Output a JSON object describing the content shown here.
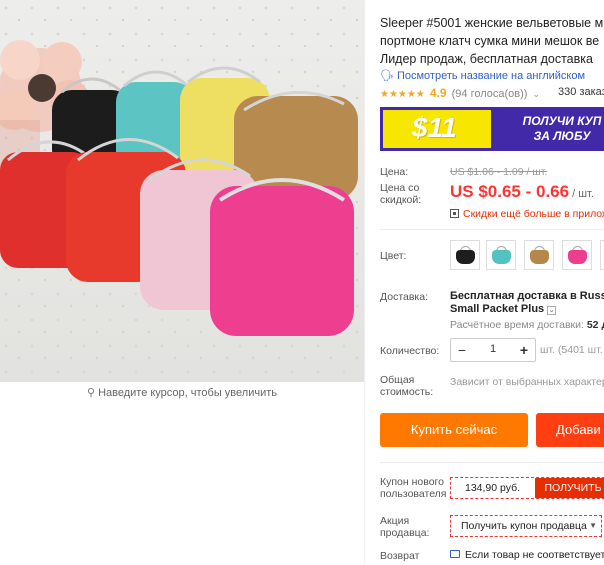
{
  "gallery": {
    "zoom_hint": "Наведите курсор, чтобы увеличить"
  },
  "product": {
    "title_lines": [
      "Sleeper #5001 женские вельветовые м",
      "портмоне клатч сумка мини мешок ве",
      "Лидер продаж, бесплатная доставка"
    ],
    "translate_link": "Посмотреть название на английском",
    "stars": "★★★★★",
    "rating": "4.9",
    "votes": "(94 голоса(ов))",
    "orders": "330 заказа"
  },
  "banner": {
    "amount": "$11",
    "promo_line1": "ПОЛУЧИ КУП",
    "promo_line2": "ЗА ЛЮБУ",
    "colors": {
      "background": "#4229a8",
      "accent": "#f7e600"
    }
  },
  "price": {
    "price_label": "Цена:",
    "old_price": "US $1.06 - 1.09 / шт.",
    "discount_label_line1": "Цена со",
    "discount_label_line2": "скидкой:",
    "current_price": "US $0.65 - 0.66",
    "unit": "/ шт.",
    "discount_note": "Скидки ещё больше в прилож"
  },
  "color": {
    "label": "Цвет:",
    "swatches": [
      {
        "name": "black",
        "color": "#1e1e1e"
      },
      {
        "name": "turquoise",
        "color": "#52c3c0"
      },
      {
        "name": "camel",
        "color": "#b4874a"
      },
      {
        "name": "pink",
        "color": "#ec3d8f"
      },
      {
        "name": "pale-pink",
        "color": "#f0c5d3"
      }
    ]
  },
  "shipping": {
    "label": "Доставка:",
    "method_line1": "Бесплатная доставка в Russian",
    "method_line2": "Small Packet Plus",
    "time_label": "Расчётное время доставки:",
    "time_value": "52 д"
  },
  "quantity": {
    "label": "Количество:",
    "value": "1",
    "minus": "−",
    "plus": "+",
    "unit_info": "шт. (5401 шт."
  },
  "total": {
    "label_line1": "Общая",
    "label_line2": "стоимость:",
    "value": "Зависит от выбранных характер"
  },
  "actions": {
    "buy_now": "Купить сейчас",
    "add_to_cart": "Добави"
  },
  "coupon": {
    "label_line1": "Купон нового",
    "label_line2": "пользователя",
    "value": "134,90 руб.",
    "button": "ПОЛУЧИТЬ"
  },
  "seller_promo": {
    "label_line1": "Акция",
    "label_line2": "продавца:",
    "select_text": "Получить купон продавца"
  },
  "returns": {
    "label": "Возврат",
    "text": "Если товар не соответствует"
  }
}
